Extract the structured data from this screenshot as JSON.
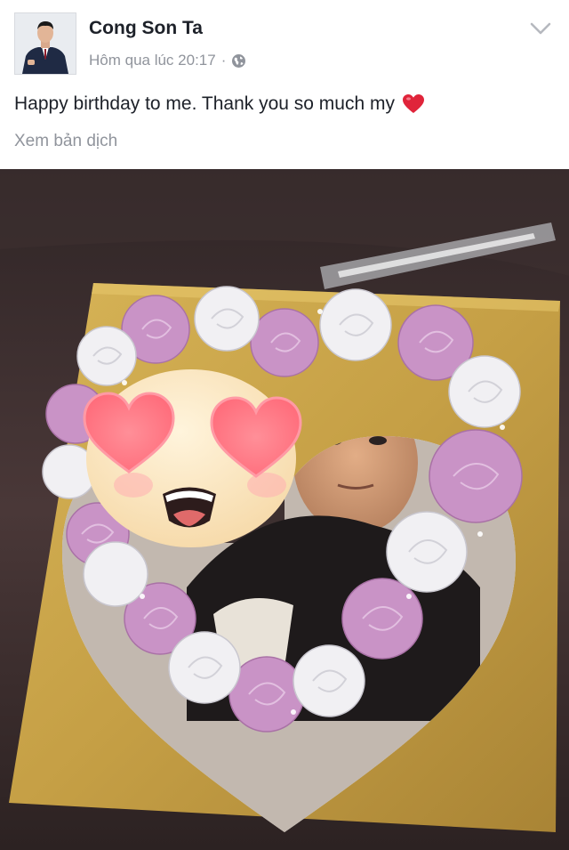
{
  "post": {
    "author_name": "Cong Son Ta",
    "timestamp": "Hôm qua lúc 20:17",
    "separator": "·",
    "privacy_icon": "globe-icon",
    "options_icon": "chevron-down-icon",
    "text": "Happy birthday to me. Thank you so much my",
    "emoji": "heart-emoji",
    "translate_link": "Xem bản dịch"
  },
  "photo": {
    "subject": "heart-shaped-birthday-cake",
    "overlay_emoji": "heart-eyes-emoji"
  },
  "colors": {
    "name_text": "#1d2129",
    "meta_text": "#90949c",
    "heart": "#e0243a",
    "cake_board": "#c9a648",
    "rosette_pink": "#c896c4",
    "rosette_white": "#efeff2",
    "table": "#3b2c2c"
  }
}
